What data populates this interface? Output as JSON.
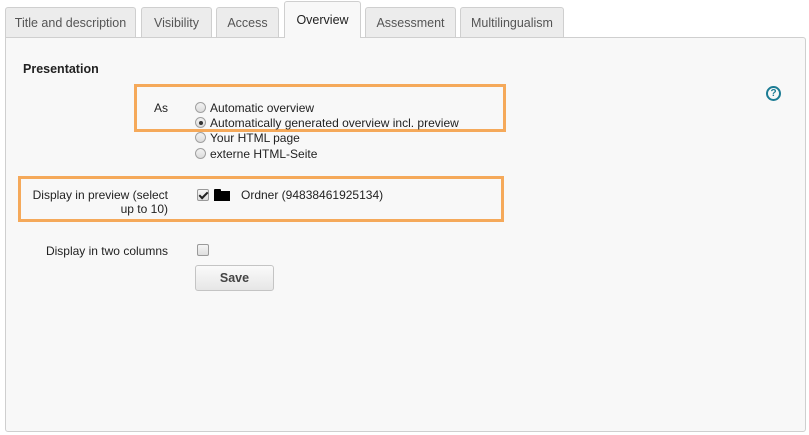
{
  "tabs": [
    {
      "label": "Title and description",
      "active": false
    },
    {
      "label": "Visibility",
      "active": false
    },
    {
      "label": "Access",
      "active": false
    },
    {
      "label": "Overview",
      "active": true
    },
    {
      "label": "Assessment",
      "active": false
    },
    {
      "label": "Multilingualism",
      "active": false
    }
  ],
  "section": {
    "title": "Presentation",
    "help_icon": "question-circle-icon"
  },
  "presentation_as": {
    "label": "As",
    "selected": 1,
    "options": [
      "Automatic overview",
      "Automatically generated overview incl. preview",
      "Your HTML page",
      "externe HTML-Seite"
    ]
  },
  "preview": {
    "label_line1": "Display in preview (select",
    "label_line2": "up to 10)",
    "item_checked": true,
    "item_icon": "folder-icon",
    "item_label": "Ordner (94838461925134)"
  },
  "two_columns": {
    "label": "Display in two columns",
    "checked": false
  },
  "save_label": "Save",
  "colors": {
    "highlight": "#f5a95a",
    "help": "#1c7c94",
    "panel_bg": "#f8f8f8"
  }
}
